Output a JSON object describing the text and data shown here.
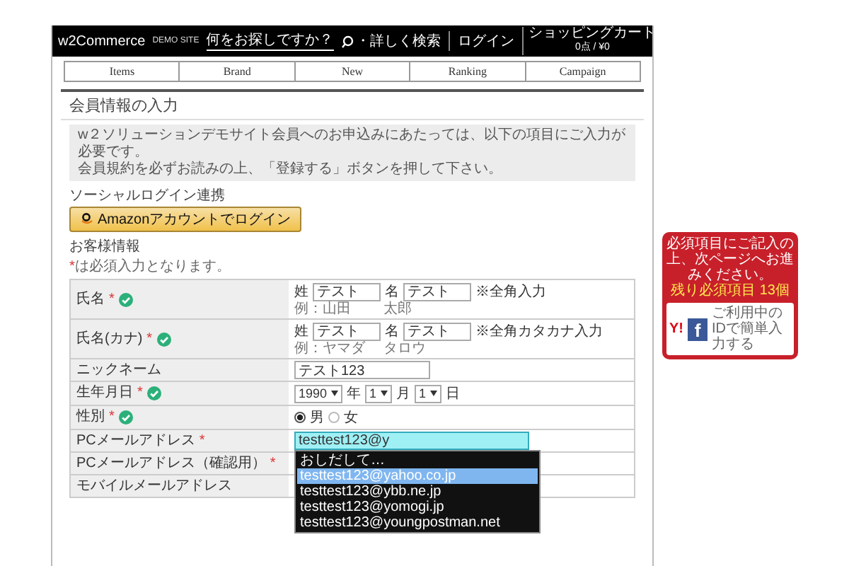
{
  "header": {
    "logo": "w2Commerce",
    "logo_sub": "DEMO SITE",
    "search": {
      "placeholder": "何をお探しですか？"
    },
    "advanced_search": "・詳しく検索",
    "login": "ログイン",
    "cart": {
      "label": "ショッピングカート",
      "summary": "0点 / ¥0"
    }
  },
  "nav": [
    {
      "label": "Items"
    },
    {
      "label": "Brand"
    },
    {
      "label": "New"
    },
    {
      "label": "Ranking"
    },
    {
      "label": "Campaign"
    }
  ],
  "page_title": "会員情報の入力",
  "notice": [
    "w２ソリューションデモサイト会員へのお申込みにあたっては、以下の項目にご入力が必要です。",
    "会員規約を必ずお読みの上、「登録する」ボタンを押して下さい。"
  ],
  "social": {
    "heading": "ソーシャルログイン連携",
    "amazon_button": "Amazonアカウントでログイン"
  },
  "customer": {
    "heading": "お客様情報",
    "required_mark": "*",
    "required_note": "は必須入力となります。"
  },
  "form_rows": [
    {
      "kind": "name",
      "label": "氏名",
      "required": true,
      "verified": true,
      "fields": [
        {
          "prefix": "姓",
          "value": "テスト",
          "example": "例：山田"
        },
        {
          "prefix": "名",
          "value": "テスト",
          "example": "太郎"
        }
      ],
      "hint": "※全角入力"
    },
    {
      "kind": "name",
      "label": "氏名(カナ)",
      "required": true,
      "verified": true,
      "fields": [
        {
          "prefix": "姓",
          "value": "テスト",
          "example": "例：ヤマダ"
        },
        {
          "prefix": "名",
          "value": "テスト",
          "example": "タロウ"
        }
      ],
      "hint": "※全角カタカナ入力"
    },
    {
      "kind": "text",
      "label": "ニックネーム",
      "required": false,
      "verified": false,
      "value": "テスト123",
      "focused": false
    },
    {
      "kind": "date",
      "label": "生年月日",
      "required": true,
      "verified": true,
      "parts": [
        {
          "value": "1990",
          "unit": "年"
        },
        {
          "value": "1",
          "unit": "月"
        },
        {
          "value": "1",
          "unit": "日"
        }
      ]
    },
    {
      "kind": "radio",
      "label": "性別",
      "required": true,
      "verified": true,
      "options": [
        {
          "label": "男",
          "selected": true
        },
        {
          "label": "女",
          "selected": false
        }
      ]
    },
    {
      "kind": "text",
      "label": "PCメールアドレス",
      "required": true,
      "verified": false,
      "value": "testtest123@y",
      "focused": true
    },
    {
      "kind": "text",
      "label": "PCメールアドレス（確認用）",
      "required": true,
      "verified": false,
      "focused": false
    },
    {
      "kind": "text",
      "label": "モバイルメールアドレス",
      "required": false,
      "verified": false,
      "focused": false
    }
  ],
  "autocomplete": {
    "header": "おしだして…",
    "items": [
      {
        "text": "testtest123@yahoo.co.jp",
        "selected": true
      },
      {
        "text": "testtest123@ybb.ne.jp",
        "selected": false
      },
      {
        "text": "testtest123@yomogi.jp",
        "selected": false
      },
      {
        "text": "testtest123@youngpostman.net",
        "selected": false
      }
    ]
  },
  "banner": {
    "message": "必須項目にご記入の上、次ページへお進みください。",
    "remaining": "残り必須項目 13個",
    "yahoo_icon": "Y!",
    "facebook_icon": "f",
    "link": "ご利用中のIDで簡単入力する"
  }
}
